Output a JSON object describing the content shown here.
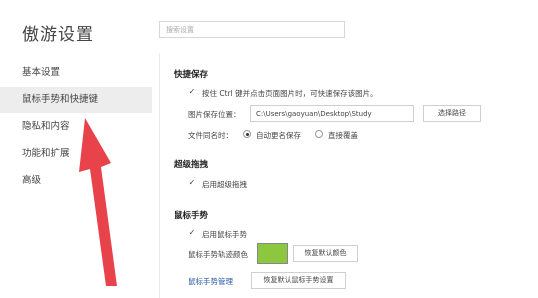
{
  "app": {
    "title": "傲游设置"
  },
  "search": {
    "placeholder": "搜索设置"
  },
  "sidebar": {
    "items": [
      {
        "label": "基本设置"
      },
      {
        "label": "鼠标手势和快捷键"
      },
      {
        "label": "隐私和内容"
      },
      {
        "label": "功能和扩展"
      },
      {
        "label": "高级"
      }
    ],
    "active_index": 1
  },
  "quick_save": {
    "title": "快捷保存",
    "enable_label": "按住 Ctrl 键并点击页面图片时，可快速保存该图片。",
    "enabled": true,
    "path_label": "图片保存位置：",
    "path_value": "C:\\Users\\gaoyuan\\Desktop\\Study",
    "choose_path_button": "选择路径",
    "same_name_label": "文件同名时：",
    "option_auto_rename": "自动更名保存",
    "option_overwrite": "直接覆盖",
    "selected_option": "auto_rename"
  },
  "super_drag": {
    "title": "超级拖拽",
    "enable_label": "启用超级拖拽",
    "enabled": true
  },
  "mouse_gesture": {
    "title": "鼠标手势",
    "enable_label": "启用鼠标手势",
    "enabled": true,
    "trail_color_label": "鼠标手势轨迹颜色",
    "trail_color": "#8dc63f",
    "restore_color_button": "恢复默认颜色",
    "manage_link": "鼠标手势管理",
    "restore_gesture_button": "恢复默认鼠标手势设置"
  },
  "colors": {
    "annotation_arrow": "#e8434a",
    "accent_link": "#2a5aa8",
    "swatch_green": "#8dc63f"
  },
  "icons": {
    "checkbox": "check-mark",
    "annotation": "red-arrow-pointing-up"
  }
}
